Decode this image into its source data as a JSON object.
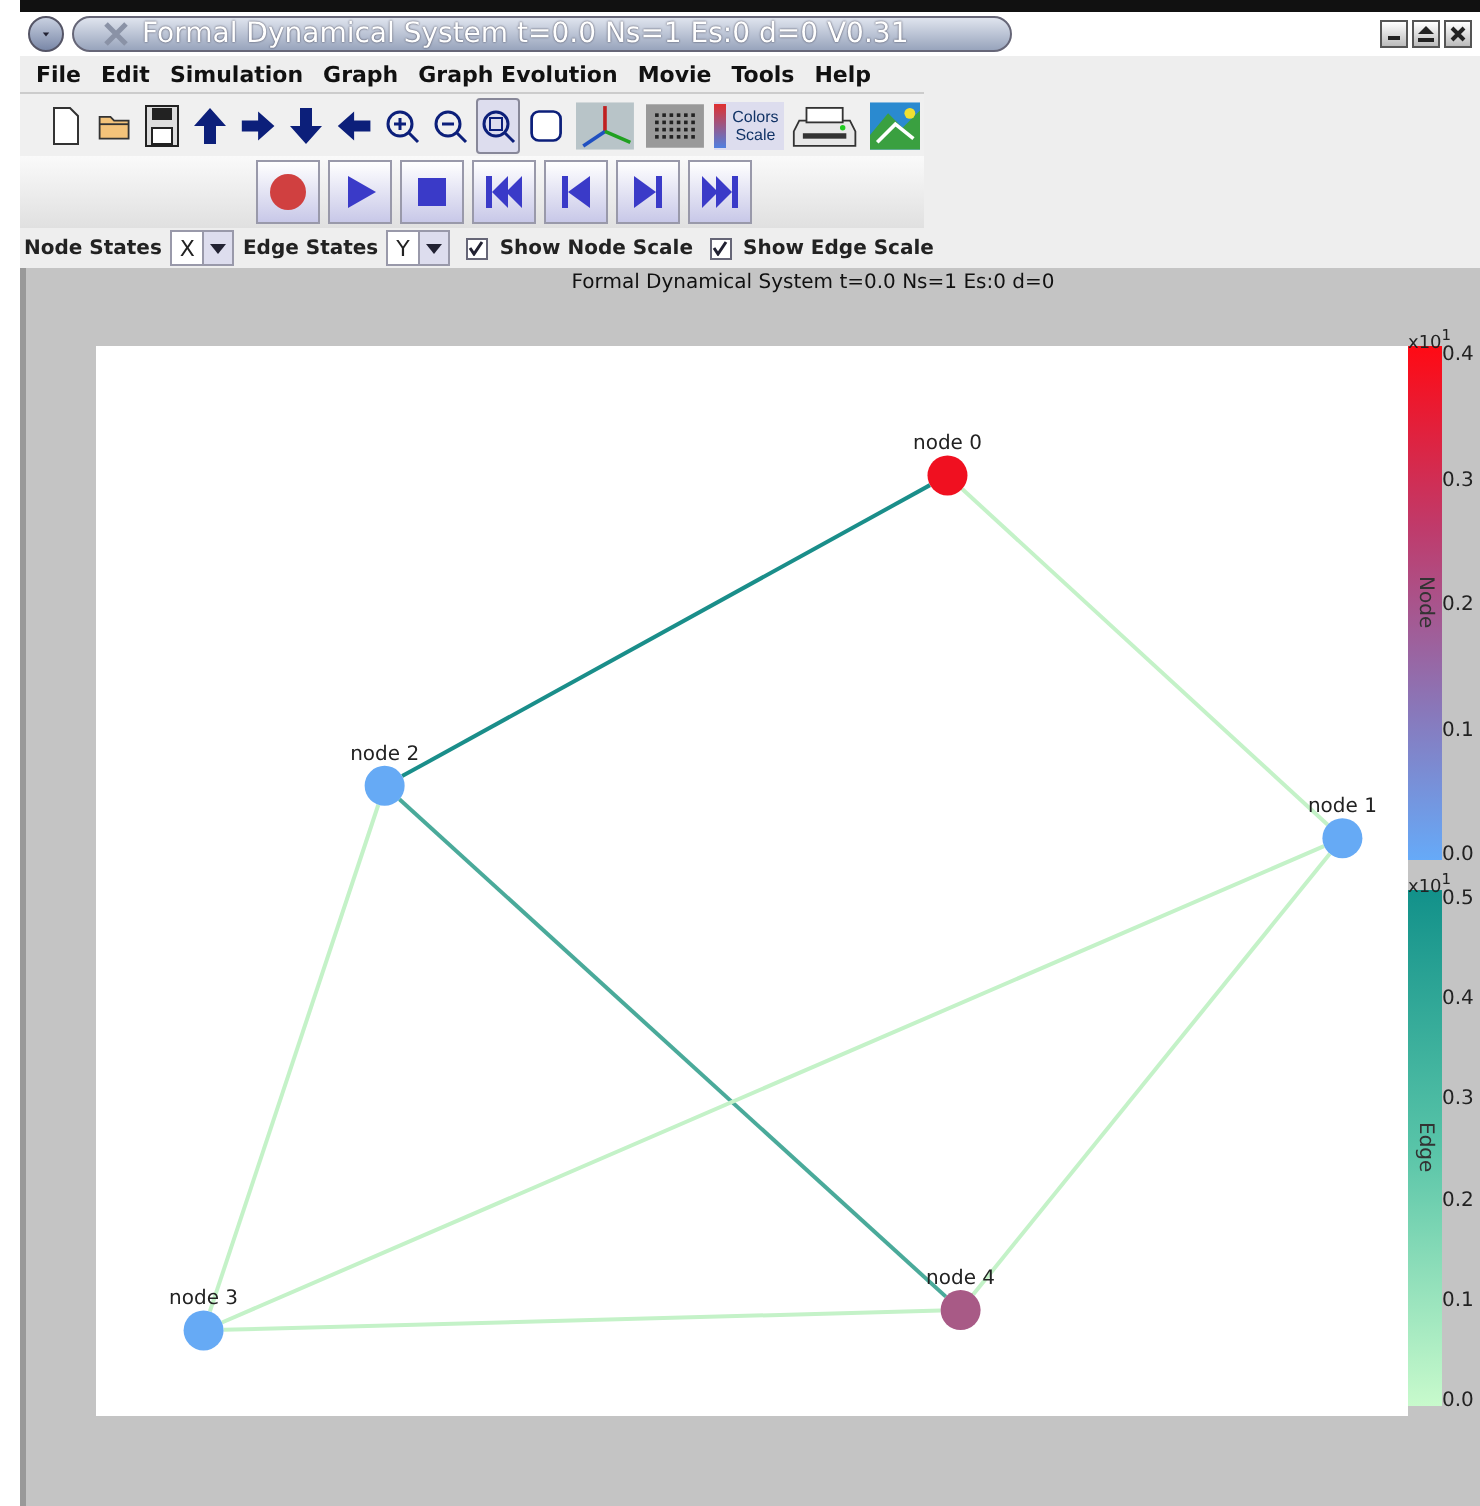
{
  "window": {
    "title": "Formal Dynamical System t=0.0 Ns=1 Es:0 d=0 V0.31"
  },
  "menu": [
    "File",
    "Edit",
    "Simulation",
    "Graph",
    "Graph Evolution",
    "Movie",
    "Tools",
    "Help"
  ],
  "toolbar": [
    {
      "kind": "new",
      "selected": false
    },
    {
      "kind": "open",
      "selected": false
    },
    {
      "kind": "save",
      "selected": false
    },
    {
      "kind": "up",
      "selected": false
    },
    {
      "kind": "right",
      "selected": false
    },
    {
      "kind": "down",
      "selected": false
    },
    {
      "kind": "left",
      "selected": false
    },
    {
      "kind": "zoom-in",
      "selected": false
    },
    {
      "kind": "zoom-out",
      "selected": false
    },
    {
      "kind": "zoom-fit",
      "selected": true
    },
    {
      "kind": "frame",
      "selected": false
    },
    {
      "kind": "axes",
      "selected": false
    },
    {
      "kind": "grid",
      "selected": false
    },
    {
      "kind": "colors",
      "selected": false,
      "label": "Colors Scale"
    },
    {
      "kind": "print",
      "selected": false
    },
    {
      "kind": "image",
      "selected": false
    }
  ],
  "playback": [
    {
      "kind": "record"
    },
    {
      "kind": "play"
    },
    {
      "kind": "stop"
    },
    {
      "kind": "first"
    },
    {
      "kind": "prev"
    },
    {
      "kind": "next"
    },
    {
      "kind": "last"
    }
  ],
  "options": {
    "node_states": {
      "label": "Node States",
      "value": "X"
    },
    "edge_states": {
      "label": "Edge States",
      "value": "Y"
    },
    "checkboxes": [
      {
        "label": "Show Node Scale",
        "checked": true
      },
      {
        "label": "Show Edge Scale",
        "checked": true
      }
    ]
  },
  "caption": "Formal Dynamical System t=0.0 Ns=1 Es:0 d=0",
  "graph": {
    "nodes": [
      {
        "label": "node 0",
        "color": "#f01020"
      },
      {
        "label": "node 1",
        "color": "#66aaf5"
      },
      {
        "label": "node 2",
        "color": "#66aaf5"
      },
      {
        "label": "node 3",
        "color": "#66aaf5"
      },
      {
        "label": "node 4",
        "color": "#a85a86"
      }
    ],
    "edges": [
      {
        "color": "#1a8e8a"
      },
      {
        "color": "#c4f2c8"
      },
      {
        "color": "#4aaa9a"
      },
      {
        "color": "#c4f2c8"
      },
      {
        "color": "#c4f2c8"
      },
      {
        "color": "#c4f2c8"
      },
      {
        "color": "#c4f2c8"
      }
    ]
  },
  "scales": [
    {
      "kind": "node",
      "exponent": "x10$^{1}$",
      "title": "Node",
      "ticks": [
        "0.4",
        "0.3",
        "0.2",
        "0.1",
        "0.0"
      ]
    },
    {
      "kind": "edge",
      "exponent": "x10$^{1}$",
      "title": "Edge",
      "ticks": [
        "0.5",
        "0.4",
        "0.3",
        "0.2",
        "0.1",
        "0.0"
      ]
    }
  ]
}
